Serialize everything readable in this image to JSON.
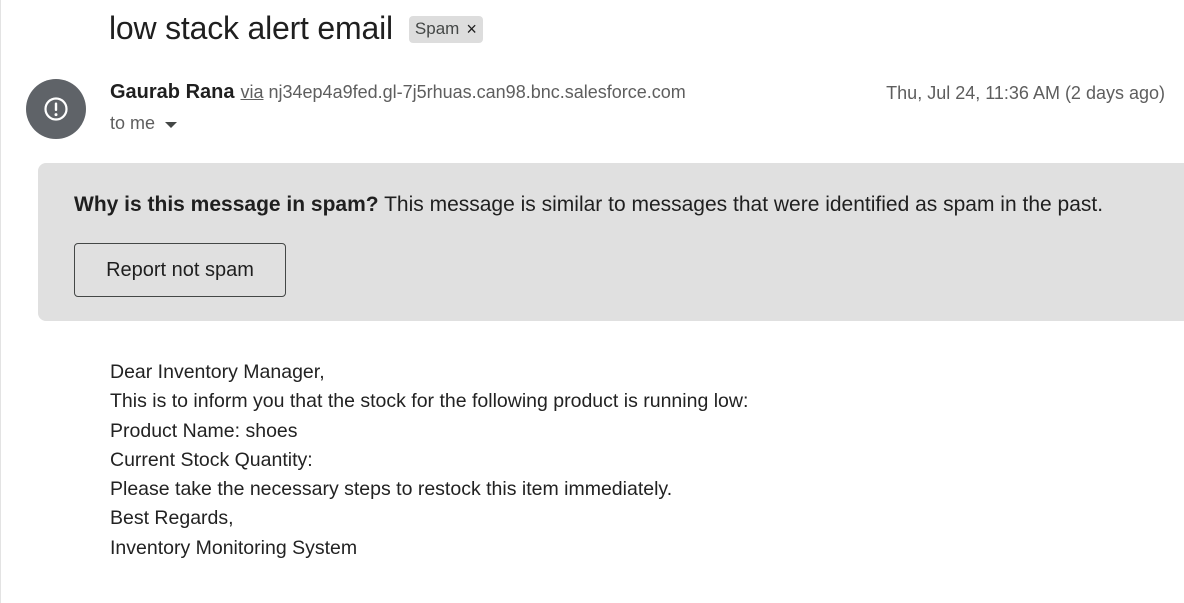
{
  "email": {
    "subject": "low stack alert email",
    "label": {
      "text": "Spam",
      "remove_icon": "×"
    },
    "sender": {
      "name": "Gaurab Rana",
      "via_text": "via",
      "via_domain": "nj34ep4a9fed.gl-7j5rhuas.can98.bnc.salesforce.com",
      "avatar_icon": "spam-warning-icon"
    },
    "date": "Thu, Jul 24, 11:36 AM (2 days ago)",
    "recipient": "to me",
    "spam_banner": {
      "question": "Why is this message in spam?",
      "explanation": "This message is similar to messages that were identified as spam in the past.",
      "button_label": "Report not spam"
    },
    "body_lines": [
      "Dear Inventory Manager,",
      "This is to inform you that the stock for the following product is running low:",
      "Product Name: shoes",
      "Current Stock Quantity:",
      "Please take the necessary steps to restock this item immediately.",
      "Best Regards,",
      "Inventory Monitoring System"
    ]
  },
  "colors": {
    "avatar_bg": "#5f6368",
    "banner_bg": "#e0e0e0",
    "chip_bg": "#dddddd",
    "secondary_text": "#5e5e5e"
  }
}
